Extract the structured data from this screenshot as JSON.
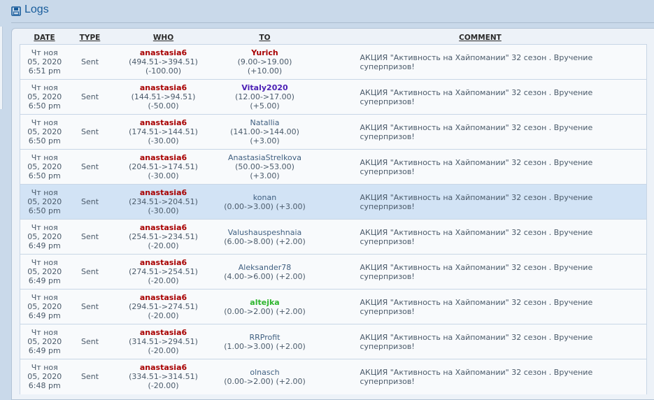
{
  "header": {
    "title": "Logs"
  },
  "colors": {
    "who": "#a80000",
    "to_red": "#a80000",
    "to_purple": "#4b1fb5",
    "to_green": "#2db52d",
    "to_plain": "#3f5f80"
  },
  "table": {
    "columns": [
      "DATE",
      "TYPE",
      "WHO",
      "TO",
      "COMMENT"
    ],
    "rows": [
      {
        "date_line1": "Чт ноя",
        "date_line2": "05, 2020",
        "date_line3": "6:51 pm",
        "type": "Sent",
        "who": "anastasia6",
        "who_balance": "(494.51->394.51)",
        "who_delta": "(-100.00)",
        "to": "Yurich",
        "to_style": "red",
        "to_balance": "(9.00->19.00)",
        "to_delta": "(+10.00)",
        "comment": "АКЦИЯ \"Активность на Хайпомании\" 32 сезон . Вручение суперпризов!",
        "highlight": false
      },
      {
        "date_line1": "Чт ноя",
        "date_line2": "05, 2020",
        "date_line3": "6:50 pm",
        "type": "Sent",
        "who": "anastasia6",
        "who_balance": "(144.51->94.51)",
        "who_delta": "(-50.00)",
        "to": "Vitaly2020",
        "to_style": "purple",
        "to_balance": "(12.00->17.00)",
        "to_delta": "(+5.00)",
        "comment": "АКЦИЯ \"Активность на Хайпомании\" 32 сезон . Вручение суперпризов!",
        "highlight": false
      },
      {
        "date_line1": "Чт ноя",
        "date_line2": "05, 2020",
        "date_line3": "6:50 pm",
        "type": "Sent",
        "who": "anastasia6",
        "who_balance": "(174.51->144.51)",
        "who_delta": "(-30.00)",
        "to": "Natallia",
        "to_style": "plain",
        "to_balance": "(141.00->144.00)",
        "to_delta": "(+3.00)",
        "comment": "АКЦИЯ \"Активность на Хайпомании\" 32 сезон . Вручение суперпризов!",
        "highlight": false
      },
      {
        "date_line1": "Чт ноя",
        "date_line2": "05, 2020",
        "date_line3": "6:50 pm",
        "type": "Sent",
        "who": "anastasia6",
        "who_balance": "(204.51->174.51)",
        "who_delta": "(-30.00)",
        "to": "AnastasiaStrelkova",
        "to_style": "plain",
        "to_balance": "(50.00->53.00)",
        "to_delta": "(+3.00)",
        "comment": "АКЦИЯ \"Активность на Хайпомании\" 32 сезон . Вручение суперпризов!",
        "highlight": false
      },
      {
        "date_line1": "Чт ноя",
        "date_line2": "05, 2020",
        "date_line3": "6:50 pm",
        "type": "Sent",
        "who": "anastasia6",
        "who_balance": "(234.51->204.51)",
        "who_delta": "(-30.00)",
        "to": "konan",
        "to_style": "plain",
        "to_balance": "(0.00->3.00)",
        "to_delta": "(+3.00)",
        "comment": "АКЦИЯ \"Активность на Хайпомании\" 32 сезон . Вручение суперпризов!",
        "highlight": true
      },
      {
        "date_line1": "Чт ноя",
        "date_line2": "05, 2020",
        "date_line3": "6:49 pm",
        "type": "Sent",
        "who": "anastasia6",
        "who_balance": "(254.51->234.51)",
        "who_delta": "(-20.00)",
        "to": "Valushauspeshnaia",
        "to_style": "plain",
        "to_balance": "(6.00->8.00)",
        "to_delta": "(+2.00)",
        "comment": "АКЦИЯ \"Активность на Хайпомании\" 32 сезон . Вручение суперпризов!",
        "highlight": false
      },
      {
        "date_line1": "Чт ноя",
        "date_line2": "05, 2020",
        "date_line3": "6:49 pm",
        "type": "Sent",
        "who": "anastasia6",
        "who_balance": "(274.51->254.51)",
        "who_delta": "(-20.00)",
        "to": "Aleksander78",
        "to_style": "plain",
        "to_balance": "(4.00->6.00)",
        "to_delta": "(+2.00)",
        "comment": "АКЦИЯ \"Активность на Хайпомании\" 32 сезон . Вручение суперпризов!",
        "highlight": false
      },
      {
        "date_line1": "Чт ноя",
        "date_line2": "05, 2020",
        "date_line3": "6:49 pm",
        "type": "Sent",
        "who": "anastasia6",
        "who_balance": "(294.51->274.51)",
        "who_delta": "(-20.00)",
        "to": "altejka",
        "to_style": "green",
        "to_balance": "(0.00->2.00)",
        "to_delta": "(+2.00)",
        "comment": "АКЦИЯ \"Активность на Хайпомании\" 32 сезон . Вручение суперпризов!",
        "highlight": false
      },
      {
        "date_line1": "Чт ноя",
        "date_line2": "05, 2020",
        "date_line3": "6:49 pm",
        "type": "Sent",
        "who": "anastasia6",
        "who_balance": "(314.51->294.51)",
        "who_delta": "(-20.00)",
        "to": "RRProfit",
        "to_style": "plain",
        "to_balance": "(1.00->3.00)",
        "to_delta": "(+2.00)",
        "comment": "АКЦИЯ \"Активность на Хайпомании\" 32 сезон . Вручение суперпризов!",
        "highlight": false
      },
      {
        "date_line1": "Чт ноя",
        "date_line2": "05, 2020",
        "date_line3": "6:48 pm",
        "type": "Sent",
        "who": "anastasia6",
        "who_balance": "(334.51->314.51)",
        "who_delta": "(-20.00)",
        "to": "olnasch",
        "to_style": "plain",
        "to_balance": "(0.00->2.00)",
        "to_delta": "(+2.00)",
        "comment": "АКЦИЯ \"Активность на Хайпомании\" 32 сезон . Вручение суперпризов!",
        "highlight": false
      }
    ]
  }
}
